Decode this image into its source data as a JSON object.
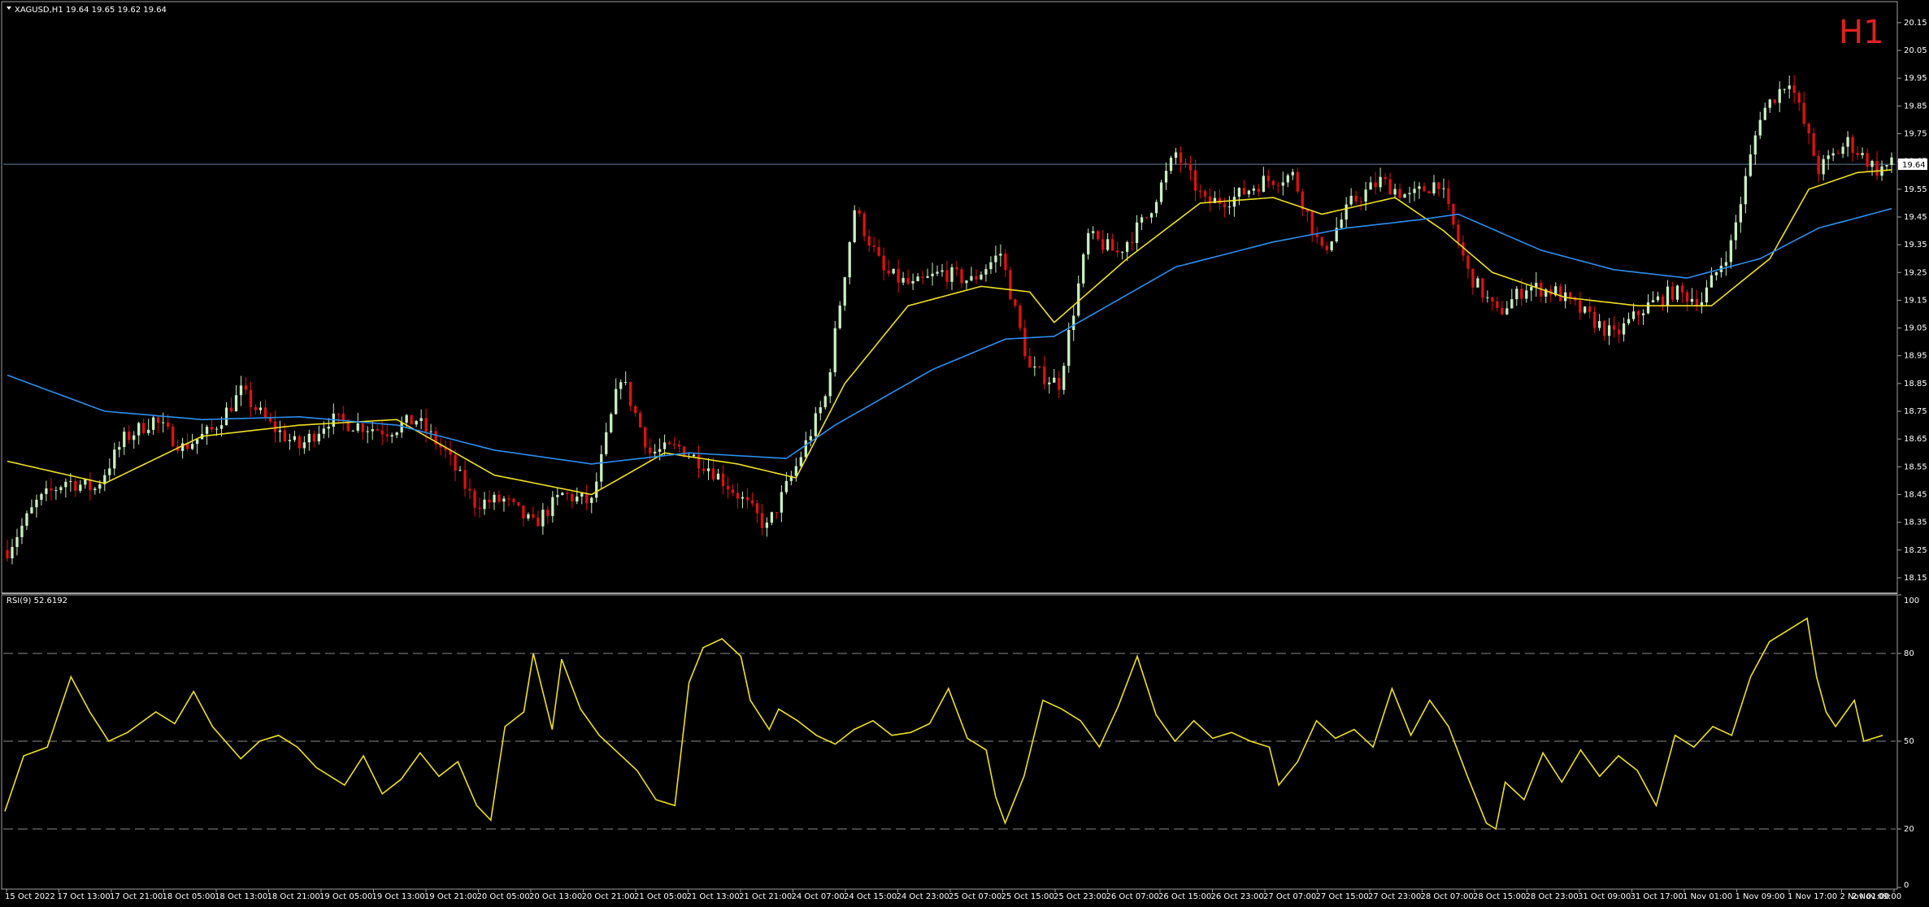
{
  "header": {
    "main_title": "XAGUSD,H1  19.64 19.65 19.62 19.64",
    "rsi_title": "RSI(9) 52.6192",
    "timeframe_badge": "H1",
    "current_price_label": "19.64"
  },
  "colors": {
    "background": "#000000",
    "frame": "#a0a0a0",
    "bull_candle": "#c8f0c0",
    "bear_candle": "#e01010",
    "ma_fast": "#f0e020",
    "ma_slow": "#2a8ff0",
    "rsi_line": "#f0e020",
    "price_line": "#6080a0",
    "level_line": "#8a8a8a"
  },
  "chart_data": [
    {
      "type": "candlestick",
      "symbol": "XAGUSD",
      "timeframe": "H1",
      "last": {
        "open": 19.64,
        "high": 19.65,
        "low": 19.62,
        "close": 19.64
      },
      "ylim": [
        18.1,
        20.22
      ],
      "y_ticks": [
        "20.15",
        "20.05",
        "19.95",
        "19.85",
        "19.75",
        "19.65",
        "19.55",
        "19.45",
        "19.35",
        "19.25",
        "19.15",
        "19.05",
        "18.95",
        "18.85",
        "18.75",
        "18.65",
        "18.55",
        "18.45",
        "18.35",
        "18.25",
        "18.15"
      ],
      "x_tick_labels": [
        "15 Oct 2022",
        "17 Oct 13:00",
        "17 Oct 21:00",
        "18 Oct 05:00",
        "18 Oct 13:00",
        "18 Oct 21:00",
        "19 Oct 05:00",
        "19 Oct 13:00",
        "19 Oct 21:00",
        "20 Oct 05:00",
        "20 Oct 13:00",
        "20 Oct 21:00",
        "21 Oct 05:00",
        "21 Oct 13:00",
        "21 Oct 21:00",
        "24 Oct 07:00",
        "24 Oct 15:00",
        "24 Oct 23:00",
        "25 Oct 07:00",
        "25 Oct 15:00",
        "25 Oct 23:00",
        "26 Oct 07:00",
        "26 Oct 15:00",
        "26 Oct 23:00",
        "27 Oct 07:00",
        "27 Oct 15:00",
        "27 Oct 23:00",
        "28 Oct 07:00",
        "28 Oct 15:00",
        "28 Oct 23:00",
        "31 Oct 09:00",
        "31 Oct 17:00",
        "1 Nov 01:00",
        "1 Nov 09:00",
        "1 Nov 17:00",
        "2 Nov 01:00",
        "2 Nov 09:00"
      ],
      "current_price": 19.64,
      "close_path": [
        [
          0,
          18.25
        ],
        [
          6,
          18.42
        ],
        [
          12,
          18.5
        ],
        [
          18,
          18.47
        ],
        [
          24,
          18.65
        ],
        [
          30,
          18.72
        ],
        [
          36,
          18.62
        ],
        [
          42,
          18.68
        ],
        [
          48,
          18.82
        ],
        [
          54,
          18.7
        ],
        [
          60,
          18.62
        ],
        [
          66,
          18.72
        ],
        [
          72,
          18.7
        ],
        [
          78,
          18.68
        ],
        [
          84,
          18.72
        ],
        [
          90,
          18.6
        ],
        [
          96,
          18.42
        ],
        [
          102,
          18.43
        ],
        [
          108,
          18.34
        ],
        [
          114,
          18.45
        ],
        [
          120,
          18.42
        ],
        [
          126,
          18.88
        ],
        [
          132,
          18.6
        ],
        [
          138,
          18.62
        ],
        [
          144,
          18.55
        ],
        [
          150,
          18.45
        ],
        [
          156,
          18.33
        ],
        [
          162,
          18.55
        ],
        [
          168,
          18.8
        ],
        [
          174,
          19.48
        ],
        [
          180,
          19.25
        ],
        [
          186,
          19.2
        ],
        [
          192,
          19.25
        ],
        [
          198,
          19.22
        ],
        [
          204,
          19.32
        ],
        [
          210,
          18.9
        ],
        [
          216,
          18.85
        ],
        [
          222,
          19.38
        ],
        [
          228,
          19.32
        ],
        [
          234,
          19.45
        ],
        [
          240,
          19.68
        ],
        [
          246,
          19.5
        ],
        [
          252,
          19.52
        ],
        [
          258,
          19.58
        ],
        [
          264,
          19.6
        ],
        [
          270,
          19.32
        ],
        [
          276,
          19.5
        ],
        [
          282,
          19.58
        ],
        [
          288,
          19.52
        ],
        [
          294,
          19.58
        ],
        [
          300,
          19.25
        ],
        [
          306,
          19.1
        ],
        [
          312,
          19.2
        ],
        [
          318,
          19.18
        ],
        [
          324,
          19.1
        ],
        [
          330,
          19.02
        ],
        [
          336,
          19.12
        ],
        [
          342,
          19.18
        ],
        [
          348,
          19.15
        ],
        [
          354,
          19.35
        ],
        [
          360,
          19.82
        ],
        [
          366,
          19.95
        ],
        [
          372,
          19.62
        ],
        [
          378,
          19.72
        ],
        [
          384,
          19.62
        ],
        [
          387,
          19.64
        ]
      ],
      "series": [
        {
          "values": [
            [
              0,
              18.57
            ],
            [
              20,
              18.49
            ],
            [
              40,
              18.66
            ],
            [
              60,
              18.7
            ],
            [
              80,
              18.72
            ],
            [
              100,
              18.52
            ],
            [
              120,
              18.45
            ],
            [
              135,
              18.6
            ],
            [
              150,
              18.56
            ],
            [
              162,
              18.51
            ],
            [
              172,
              18.85
            ],
            [
              185,
              19.13
            ],
            [
              200,
              19.2
            ],
            [
              210,
              19.18
            ],
            [
              215,
              19.07
            ],
            [
              230,
              19.3
            ],
            [
              245,
              19.5
            ],
            [
              260,
              19.52
            ],
            [
              270,
              19.46
            ],
            [
              285,
              19.52
            ],
            [
              295,
              19.4
            ],
            [
              305,
              19.25
            ],
            [
              320,
              19.16
            ],
            [
              335,
              19.13
            ],
            [
              350,
              19.13
            ],
            [
              362,
              19.3
            ],
            [
              370,
              19.55
            ],
            [
              380,
              19.61
            ],
            [
              387,
              19.62
            ]
          ]
        },
        {
          "values": [
            [
              0,
              18.88
            ],
            [
              20,
              18.75
            ],
            [
              40,
              18.72
            ],
            [
              60,
              18.73
            ],
            [
              80,
              18.7
            ],
            [
              100,
              18.61
            ],
            [
              120,
              18.56
            ],
            [
              140,
              18.6
            ],
            [
              160,
              18.58
            ],
            [
              170,
              18.7
            ],
            [
              190,
              18.9
            ],
            [
              205,
              19.01
            ],
            [
              215,
              19.02
            ],
            [
              240,
              19.27
            ],
            [
              260,
              19.36
            ],
            [
              275,
              19.41
            ],
            [
              290,
              19.44
            ],
            [
              298,
              19.46
            ],
            [
              315,
              19.33
            ],
            [
              330,
              19.26
            ],
            [
              345,
              19.23
            ],
            [
              360,
              19.3
            ],
            [
              372,
              19.41
            ],
            [
              387,
              19.48
            ]
          ]
        }
      ]
    },
    {
      "type": "line",
      "title": "RSI(9) 52.6192",
      "value": 52.6192,
      "ylim": [
        0,
        100
      ],
      "y_ticks": [
        "100",
        "80",
        "50",
        "20",
        "0"
      ],
      "levels": [
        80,
        50,
        20
      ],
      "series": [
        {
          "values": [
            [
              0,
              26
            ],
            [
              4,
              45
            ],
            [
              9,
              48
            ],
            [
              14,
              72
            ],
            [
              18,
              60
            ],
            [
              22,
              50
            ],
            [
              26,
              53
            ],
            [
              32,
              60
            ],
            [
              36,
              56
            ],
            [
              40,
              67
            ],
            [
              44,
              55
            ],
            [
              50,
              44
            ],
            [
              54,
              50
            ],
            [
              58,
              52
            ],
            [
              62,
              48
            ],
            [
              66,
              41
            ],
            [
              72,
              35
            ],
            [
              76,
              45
            ],
            [
              80,
              32
            ],
            [
              84,
              37
            ],
            [
              88,
              46
            ],
            [
              92,
              38
            ],
            [
              96,
              43
            ],
            [
              100,
              28
            ],
            [
              103,
              23
            ],
            [
              106,
              55
            ],
            [
              110,
              60
            ],
            [
              112,
              80
            ],
            [
              116,
              54
            ],
            [
              118,
              78
            ],
            [
              122,
              61
            ],
            [
              126,
              52
            ],
            [
              130,
              46
            ],
            [
              134,
              40
            ],
            [
              138,
              30
            ],
            [
              142,
              28
            ],
            [
              145,
              70
            ],
            [
              148,
              82
            ],
            [
              152,
              85
            ],
            [
              156,
              79
            ],
            [
              158,
              64
            ],
            [
              162,
              54
            ],
            [
              164,
              61
            ],
            [
              168,
              57
            ],
            [
              172,
              52
            ],
            [
              176,
              49
            ],
            [
              180,
              54
            ],
            [
              184,
              57
            ],
            [
              188,
              52
            ],
            [
              192,
              53
            ],
            [
              196,
              56
            ],
            [
              200,
              68
            ],
            [
              204,
              51
            ],
            [
              208,
              47
            ],
            [
              210,
              31
            ],
            [
              212,
              22
            ],
            [
              216,
              38
            ],
            [
              220,
              64
            ],
            [
              224,
              61
            ],
            [
              228,
              57
            ],
            [
              232,
              48
            ],
            [
              236,
              62
            ],
            [
              240,
              79
            ],
            [
              244,
              59
            ],
            [
              248,
              50
            ],
            [
              252,
              57
            ],
            [
              256,
              51
            ],
            [
              260,
              53
            ],
            [
              264,
              50
            ],
            [
              268,
              48
            ],
            [
              270,
              35
            ],
            [
              274,
              43
            ],
            [
              278,
              57
            ],
            [
              282,
              51
            ],
            [
              286,
              54
            ],
            [
              290,
              48
            ],
            [
              294,
              68
            ],
            [
              298,
              52
            ],
            [
              302,
              64
            ],
            [
              306,
              55
            ],
            [
              310,
              38
            ],
            [
              314,
              22
            ],
            [
              316,
              20
            ],
            [
              318,
              36
            ],
            [
              322,
              30
            ],
            [
              326,
              46
            ],
            [
              330,
              36
            ],
            [
              334,
              47
            ],
            [
              338,
              38
            ],
            [
              342,
              45
            ],
            [
              346,
              40
            ],
            [
              350,
              28
            ],
            [
              354,
              52
            ],
            [
              358,
              48
            ],
            [
              362,
              55
            ],
            [
              366,
              52
            ],
            [
              370,
              72
            ],
            [
              374,
              84
            ],
            [
              378,
              88
            ],
            [
              382,
              92
            ],
            [
              384,
              72
            ],
            [
              386,
              60
            ],
            [
              388,
              55
            ],
            [
              392,
              64
            ],
            [
              394,
              50
            ],
            [
              398,
              52
            ]
          ]
        }
      ]
    }
  ]
}
